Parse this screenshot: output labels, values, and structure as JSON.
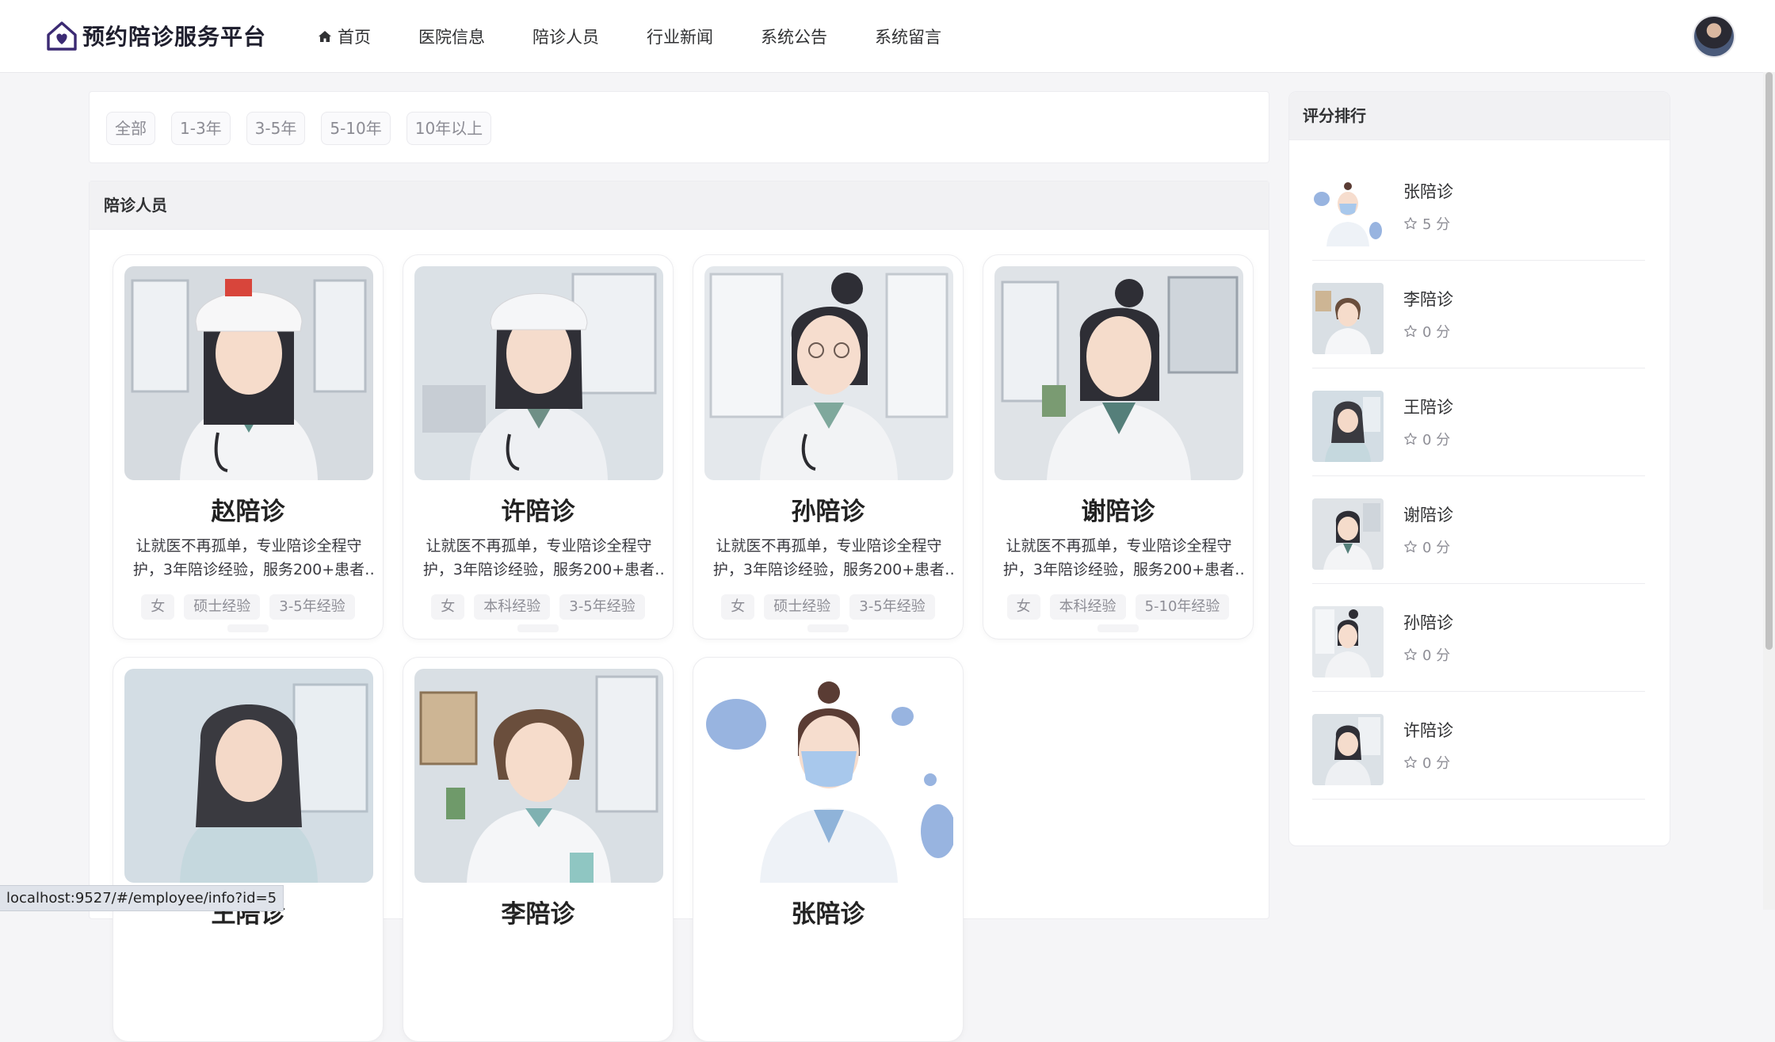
{
  "header": {
    "title": "预约陪诊服务平台",
    "nav": [
      {
        "label": "首页",
        "icon": "home-icon"
      },
      {
        "label": "医院信息"
      },
      {
        "label": "陪诊人员"
      },
      {
        "label": "行业新闻"
      },
      {
        "label": "系统公告"
      },
      {
        "label": "系统留言"
      }
    ],
    "brand_color": "#3b2a73"
  },
  "filters": [
    "全部",
    "1-3年",
    "3-5年",
    "5-10年",
    "10年以上"
  ],
  "staff": {
    "heading": "陪诊人员",
    "cards": [
      {
        "name": "赵陪诊",
        "desc": "让就医不再孤单，专业陪诊全程守护，3年陪诊经验，服务200+患者 …",
        "tags": [
          "女",
          "硕士经验",
          "3-5年经验"
        ]
      },
      {
        "name": "许陪诊",
        "desc": "让就医不再孤单，专业陪诊全程守护，3年陪诊经验，服务200+患者 …",
        "tags": [
          "女",
          "本科经验",
          "3-5年经验"
        ]
      },
      {
        "name": "孙陪诊",
        "desc": "让就医不再孤单，专业陪诊全程守护，3年陪诊经验，服务200+患者 …",
        "tags": [
          "女",
          "硕士经验",
          "3-5年经验"
        ]
      },
      {
        "name": "谢陪诊",
        "desc": "让就医不再孤单，专业陪诊全程守护，3年陪诊经验，服务200+患者 …",
        "tags": [
          "女",
          "本科经验",
          "5-10年经验"
        ]
      },
      {
        "name": "王陪诊",
        "desc": "",
        "tags": []
      },
      {
        "name": "李陪诊",
        "desc": "",
        "tags": []
      },
      {
        "name": "张陪诊",
        "desc": "",
        "tags": []
      }
    ]
  },
  "ranking": {
    "heading": "评分排行",
    "items": [
      {
        "name": "张陪诊",
        "score": "5 分"
      },
      {
        "name": "李陪诊",
        "score": "0 分"
      },
      {
        "name": "王陪诊",
        "score": "0 分"
      },
      {
        "name": "谢陪诊",
        "score": "0 分"
      },
      {
        "name": "孙陪诊",
        "score": "0 分"
      },
      {
        "name": "许陪诊",
        "score": "0 分"
      }
    ]
  },
  "status_url": "localhost:9527/#/employee/info?id=5"
}
